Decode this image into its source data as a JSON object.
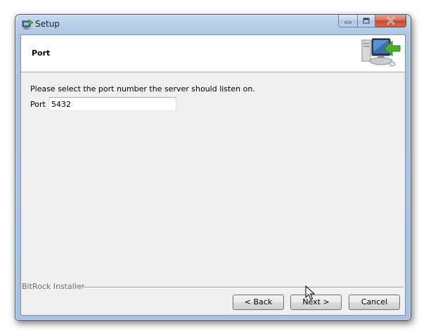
{
  "window": {
    "title": "Setup"
  },
  "header": {
    "title": "Port",
    "icon": "computer-arrow-icon"
  },
  "main": {
    "prompt": "Please select the port number the server should listen on.",
    "port_label": "Port",
    "port_value": "5432"
  },
  "footer": {
    "group_label": "BitRock Installer",
    "back_label": "< Back",
    "next_label": "Next >",
    "cancel_label": "Cancel"
  },
  "colors": {
    "titlebar": "#b9cfe9",
    "client_bg": "#f0f0f0",
    "close_button": "#c54a2c",
    "accent_arrow": "#4caf2a"
  }
}
